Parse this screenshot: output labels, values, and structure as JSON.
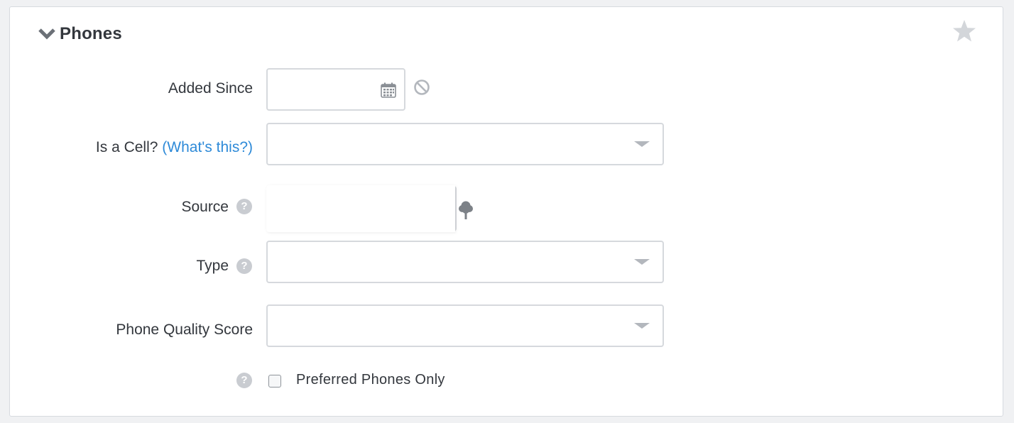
{
  "panel": {
    "title": "Phones",
    "chevron_icon": "chevron-down-icon",
    "star_icon": "star-icon"
  },
  "fields": {
    "added_since": {
      "label": "Added Since",
      "value": "",
      "calendar_icon": "calendar-icon",
      "clear_icon": "ban-icon"
    },
    "is_cell": {
      "label": "Is a Cell?",
      "link": "(What's this?)",
      "value": ""
    },
    "source": {
      "label": "Source",
      "help": "?",
      "value": "",
      "tree_icon": "tree-icon"
    },
    "type": {
      "label": "Type",
      "help": "?",
      "value": ""
    },
    "phone_quality_score": {
      "label": "Phone Quality Score",
      "value": ""
    },
    "preferred_only": {
      "help": "?",
      "label": "Preferred Phones Only",
      "checked": false
    }
  },
  "colors": {
    "link": "#2e8ad8",
    "text": "#33373d",
    "border": "#d6d9dd",
    "icon_gray": "#b3b7bd"
  }
}
